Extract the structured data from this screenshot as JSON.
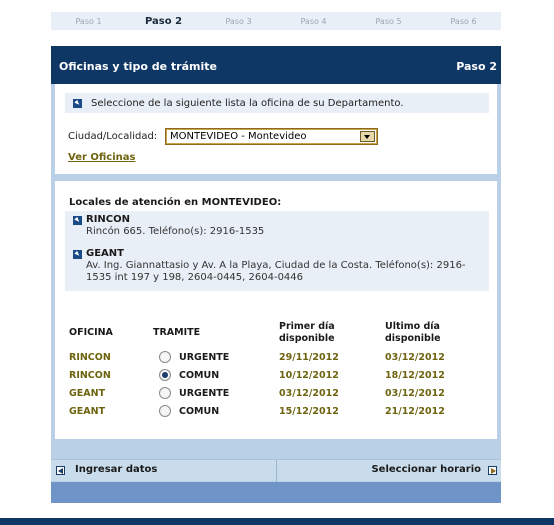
{
  "steps": [
    "Paso 1",
    "Paso 2",
    "Paso 3",
    "Paso 4",
    "Paso 5",
    "Paso 6"
  ],
  "active_step": "Paso 2",
  "panel": {
    "title": "Oficinas y tipo de trámite",
    "step_label": "Paso 2"
  },
  "office_select": {
    "instruction": "Seleccione de la siguiente lista la oficina de su Departamento.",
    "label": "Ciudad/Localidad:",
    "selected": "MONTEVIDEO - Montevideo",
    "link": "Ver Oficinas"
  },
  "locales": {
    "title": "Locales de atención en MONTEVIDEO:",
    "items": [
      {
        "name": "RINCON",
        "address": "Rincón 665. Teléfono(s): 2916-1535"
      },
      {
        "name": "GEANT",
        "address": "Av. Ing. Giannattasio y Av. A la Playa, Ciudad de la Costa. Teléfono(s): 2916-1535 int 197 y 198, 2604-0445, 2604-0446"
      }
    ]
  },
  "table": {
    "headers": {
      "office": "OFICINA",
      "tramite": "TRAMITE",
      "primer": "Primer día disponible",
      "ultimo": "Ultimo día disponible"
    },
    "rows": [
      {
        "office": "RINCON",
        "tramite": "URGENTE",
        "primer": "29/11/2012",
        "ultimo": "03/12/2012",
        "selected": false
      },
      {
        "office": "RINCON",
        "tramite": "COMUN",
        "primer": "10/12/2012",
        "ultimo": "18/12/2012",
        "selected": true
      },
      {
        "office": "GEANT",
        "tramite": "URGENTE",
        "primer": "03/12/2012",
        "ultimo": "03/12/2012",
        "selected": false
      },
      {
        "office": "GEANT",
        "tramite": "COMUN",
        "primer": "15/12/2012",
        "ultimo": "21/12/2012",
        "selected": false
      }
    ]
  },
  "footer": {
    "back": "Ingresar datos",
    "next": "Seleccionar horario"
  },
  "colors": {
    "header": "#0e3766",
    "frame": "#b9d0e7",
    "accent_text": "#6e6410",
    "strip": "#e9eff6"
  }
}
